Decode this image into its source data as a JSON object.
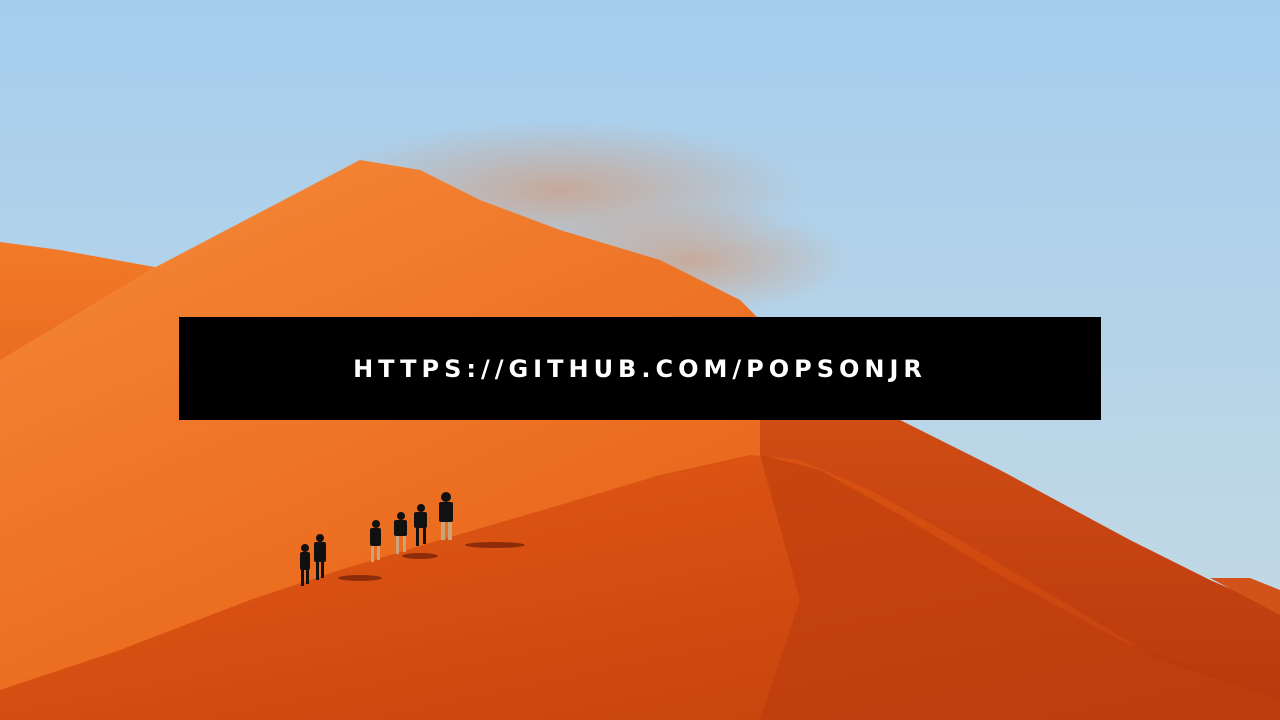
{
  "banner": {
    "text": "HTTPS://GITHUB.COM/POPSONJR"
  },
  "colors": {
    "sky_top": "#a5cdee",
    "sky_bottom": "#c3d7df",
    "dune_light": "#f07a2a",
    "dune_mid": "#dd5a16",
    "dune_shadow": "#b8340b",
    "banner_bg": "#000000",
    "banner_text": "#ffffff"
  }
}
